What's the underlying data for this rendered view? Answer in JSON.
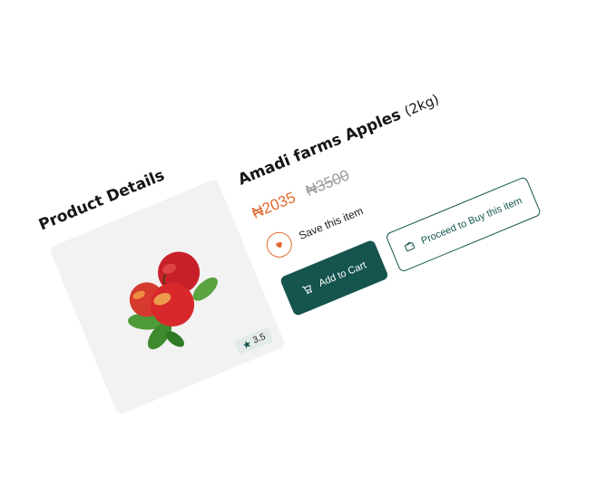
{
  "section": {
    "title": "Product Details"
  },
  "product": {
    "name": "Amadi farms Apples",
    "weight": "(2kg)",
    "price_current": "₦2035",
    "price_old": "₦3500",
    "rating": "3.5",
    "image_icon": "apples-image"
  },
  "actions": {
    "save_label": "Save this item",
    "add_to_cart_label": "Add to Cart",
    "buy_label": "Proceed to Buy this item"
  },
  "colors": {
    "primary": "#15544f",
    "accent": "#e06a2c",
    "old_price": "#9c9c9c",
    "card_bg": "#f2f2f2"
  }
}
